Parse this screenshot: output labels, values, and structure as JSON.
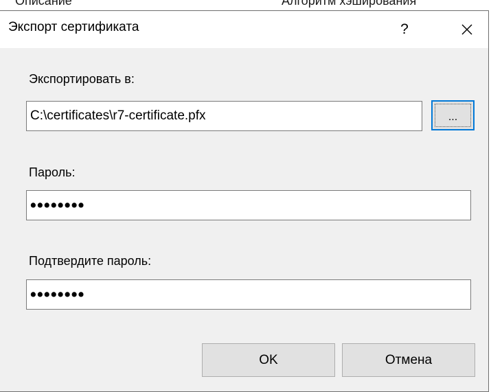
{
  "background_window": {
    "fragment_left": "Описание",
    "fragment_right": "Алгоритм хэширования"
  },
  "dialog": {
    "title": "Экспорт сертификата",
    "help_glyph": "?",
    "close_glyph": "✕",
    "export_label": "Экспортировать в:",
    "export_path": "C:\\certificates\\r7-certificate.pfx",
    "browse_label": "...",
    "password_label": "Пароль:",
    "password_value": "••••••••",
    "confirm_label": "Подтвердите пароль:",
    "confirm_value": "••••••••",
    "ok_label": "OK",
    "cancel_label": "Отмена"
  },
  "colors": {
    "dialog_background": "#f0f0f0",
    "titlebar_background": "#ffffff",
    "focus_border": "#0078d7",
    "button_face": "#e1e1e1"
  }
}
